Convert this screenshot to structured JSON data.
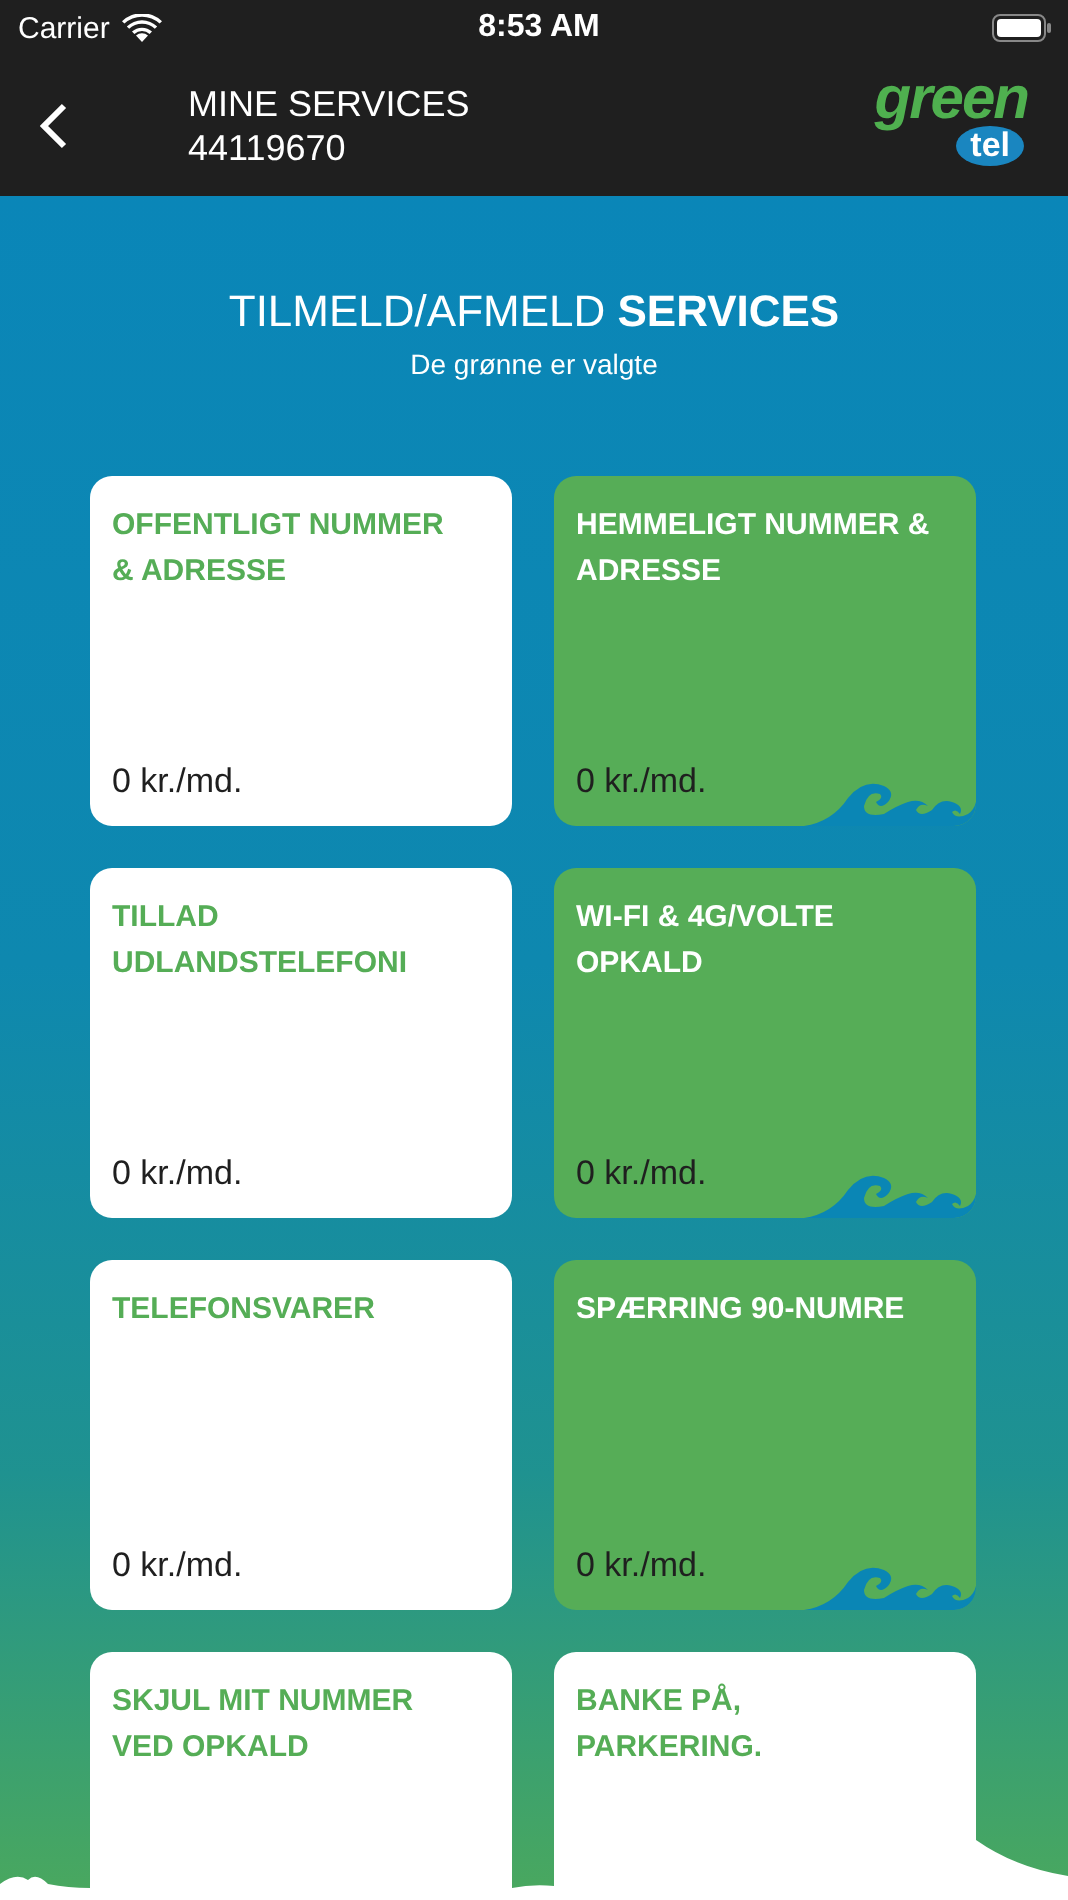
{
  "status_bar": {
    "carrier": "Carrier",
    "time": "8:53 AM"
  },
  "header": {
    "title": "MINE SERVICES",
    "subtitle": "44119670",
    "logo": {
      "word": "green",
      "badge": "tel"
    }
  },
  "heading": {
    "normal": "TILMELD/AFMELD ",
    "bold": "SERVICES",
    "subtitle": "De grønne er valgte"
  },
  "services": [
    {
      "title": "OFFENTLIGT NUMMER & ADRESSE",
      "price": "0 kr./md.",
      "selected": false
    },
    {
      "title": "HEMMELIGT NUMMER & ADRESSE",
      "price": "0 kr./md.",
      "selected": true
    },
    {
      "title": "TILLAD UDLANDSTELEFONI",
      "price": "0 kr./md.",
      "selected": false
    },
    {
      "title": "WI-FI & 4G/VOLTE OPKALD",
      "price": "0 kr./md.",
      "selected": true
    },
    {
      "title": "TELEFONSVARER",
      "price": "0 kr./md.",
      "selected": false
    },
    {
      "title": "SPÆRRING 90-NUMRE",
      "price": "0 kr./md.",
      "selected": true
    },
    {
      "title": "SKJUL MIT NUMMER VED OPKALD",
      "selected": false
    },
    {
      "title": "BANKE PÅ, PARKERING.",
      "selected": false
    }
  ]
}
